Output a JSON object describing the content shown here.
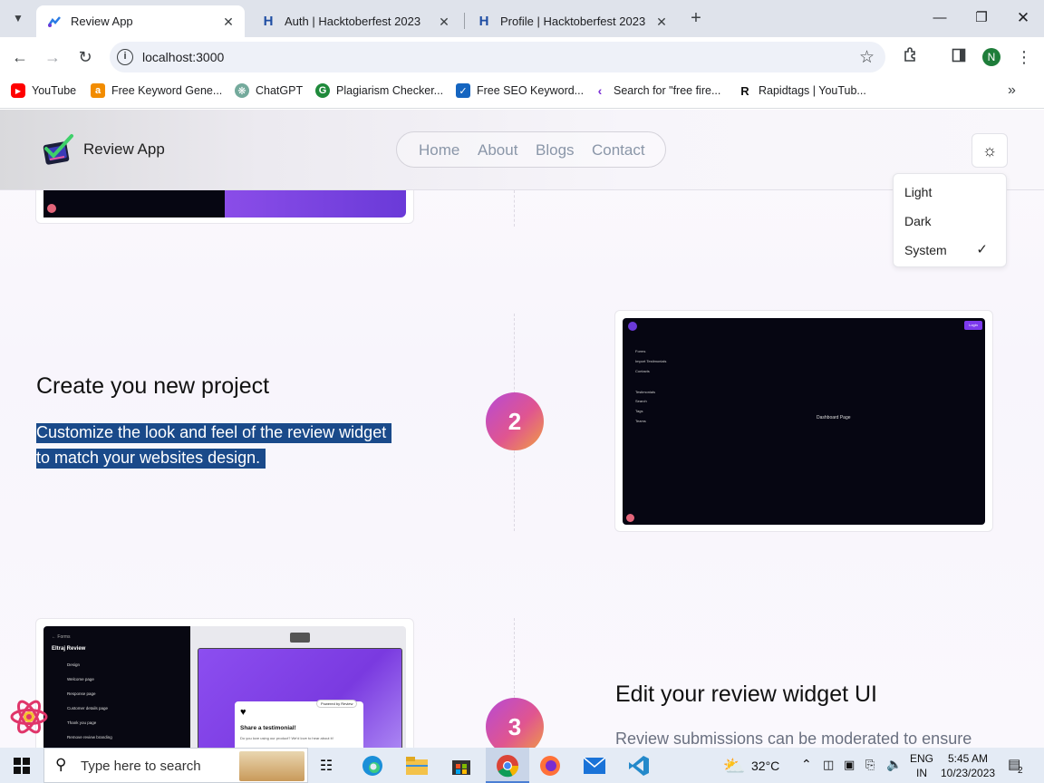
{
  "browser": {
    "tabs": [
      {
        "title": "Review App",
        "active": true
      },
      {
        "title": "Auth | Hacktoberfest 2023",
        "active": false
      },
      {
        "title": "Profile | Hacktoberfest 2023",
        "active": false
      }
    ],
    "address": "localhost:3000",
    "profile_initial": "N",
    "bookmarks": [
      {
        "label": "YouTube",
        "color": "#ff0000"
      },
      {
        "label": "Free Keyword Gene...",
        "color": "#f28c00"
      },
      {
        "label": "ChatGPT",
        "color": "#74aa9c"
      },
      {
        "label": "Plagiarism Checker...",
        "color": "#1f8a3b"
      },
      {
        "label": "Free SEO Keyword...",
        "color": "#1565c0"
      },
      {
        "label": "Search for \"free fire...",
        "color": "#7b2fd6"
      },
      {
        "label": "Rapidtags | YouTub...",
        "color": "#111111"
      }
    ]
  },
  "site": {
    "brand": "Review App",
    "nav": [
      "Home",
      "About",
      "Blogs",
      "Contact"
    ],
    "theme_menu": {
      "items": [
        "Light",
        "Dark",
        "System"
      ],
      "selected": "System"
    },
    "step2": {
      "number": "2",
      "title": "Create you new project",
      "description_line1": "Customize the look and feel of the review widget",
      "description_line2": "to match your websites design.",
      "preview": {
        "login": "Login",
        "menu": [
          "Forms",
          "Import Testimonials",
          "Contacts"
        ],
        "menu2": [
          "Testimonials",
          "Search",
          "Tags",
          "Teams"
        ],
        "center": "Dashboard Page"
      }
    },
    "step3": {
      "number": "3",
      "title": "Edit your review widget UI",
      "description": "Review submissions can be moderated to ensure",
      "preview": {
        "back": "← Forms",
        "name": "Eltraj Review",
        "items": [
          "Design",
          "Welcome page",
          "Response page",
          "Customer details page",
          "Thank you page",
          "Remove review branding"
        ],
        "powered": "Powered by Review",
        "share": "Share a testimonial!",
        "sub": "Do you love using our product? We'd love to hear about it!"
      }
    }
  },
  "taskbar": {
    "search_placeholder": "Type here to search",
    "weather": "32°C",
    "lang1": "ENG",
    "lang2": "IN",
    "time": "5:45 AM",
    "date": "10/23/2023",
    "notifications": "2"
  }
}
